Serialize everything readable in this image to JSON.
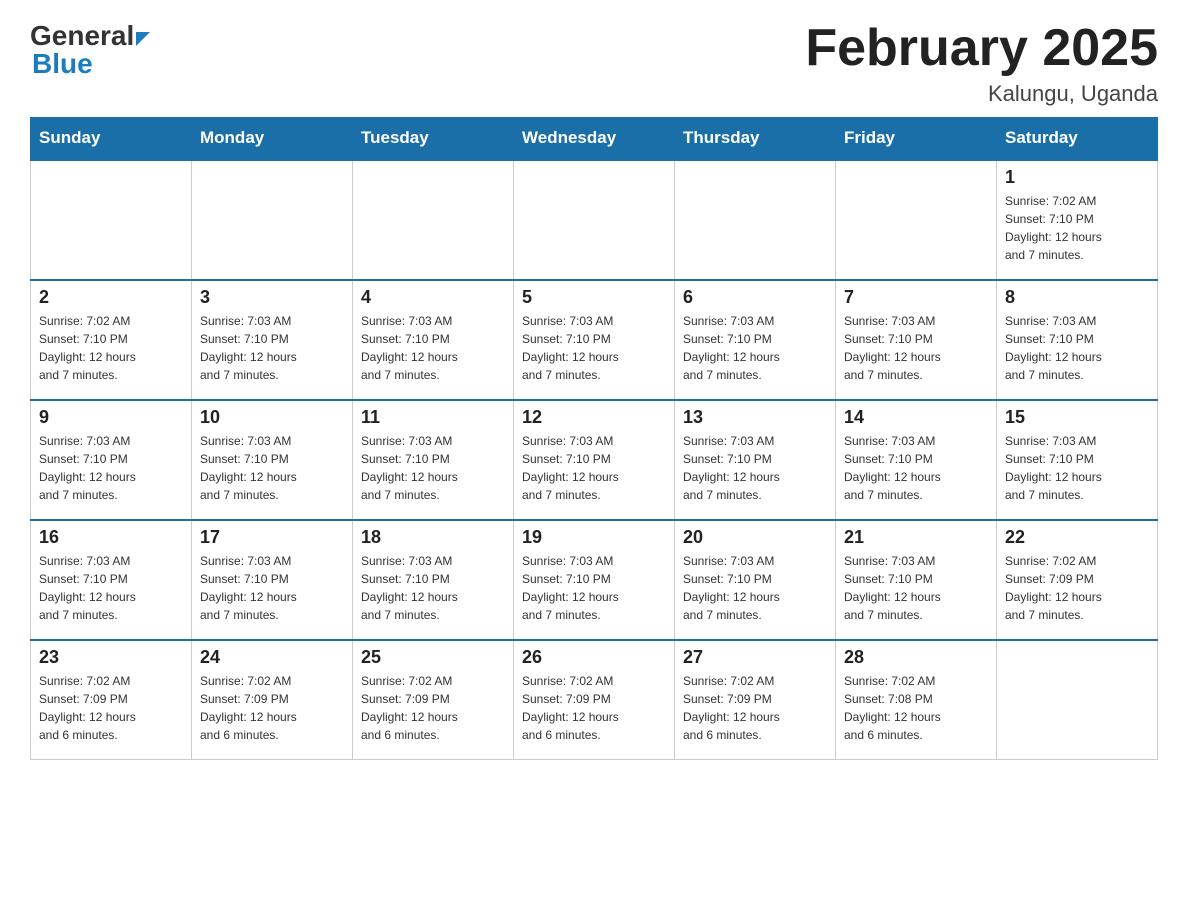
{
  "header": {
    "logo_general": "General",
    "logo_blue": "Blue",
    "title": "February 2025",
    "location": "Kalungu, Uganda"
  },
  "days_of_week": [
    "Sunday",
    "Monday",
    "Tuesday",
    "Wednesday",
    "Thursday",
    "Friday",
    "Saturday"
  ],
  "weeks": [
    [
      {
        "day": "",
        "info": ""
      },
      {
        "day": "",
        "info": ""
      },
      {
        "day": "",
        "info": ""
      },
      {
        "day": "",
        "info": ""
      },
      {
        "day": "",
        "info": ""
      },
      {
        "day": "",
        "info": ""
      },
      {
        "day": "1",
        "info": "Sunrise: 7:02 AM\nSunset: 7:10 PM\nDaylight: 12 hours\nand 7 minutes."
      }
    ],
    [
      {
        "day": "2",
        "info": "Sunrise: 7:02 AM\nSunset: 7:10 PM\nDaylight: 12 hours\nand 7 minutes."
      },
      {
        "day": "3",
        "info": "Sunrise: 7:03 AM\nSunset: 7:10 PM\nDaylight: 12 hours\nand 7 minutes."
      },
      {
        "day": "4",
        "info": "Sunrise: 7:03 AM\nSunset: 7:10 PM\nDaylight: 12 hours\nand 7 minutes."
      },
      {
        "day": "5",
        "info": "Sunrise: 7:03 AM\nSunset: 7:10 PM\nDaylight: 12 hours\nand 7 minutes."
      },
      {
        "day": "6",
        "info": "Sunrise: 7:03 AM\nSunset: 7:10 PM\nDaylight: 12 hours\nand 7 minutes."
      },
      {
        "day": "7",
        "info": "Sunrise: 7:03 AM\nSunset: 7:10 PM\nDaylight: 12 hours\nand 7 minutes."
      },
      {
        "day": "8",
        "info": "Sunrise: 7:03 AM\nSunset: 7:10 PM\nDaylight: 12 hours\nand 7 minutes."
      }
    ],
    [
      {
        "day": "9",
        "info": "Sunrise: 7:03 AM\nSunset: 7:10 PM\nDaylight: 12 hours\nand 7 minutes."
      },
      {
        "day": "10",
        "info": "Sunrise: 7:03 AM\nSunset: 7:10 PM\nDaylight: 12 hours\nand 7 minutes."
      },
      {
        "day": "11",
        "info": "Sunrise: 7:03 AM\nSunset: 7:10 PM\nDaylight: 12 hours\nand 7 minutes."
      },
      {
        "day": "12",
        "info": "Sunrise: 7:03 AM\nSunset: 7:10 PM\nDaylight: 12 hours\nand 7 minutes."
      },
      {
        "day": "13",
        "info": "Sunrise: 7:03 AM\nSunset: 7:10 PM\nDaylight: 12 hours\nand 7 minutes."
      },
      {
        "day": "14",
        "info": "Sunrise: 7:03 AM\nSunset: 7:10 PM\nDaylight: 12 hours\nand 7 minutes."
      },
      {
        "day": "15",
        "info": "Sunrise: 7:03 AM\nSunset: 7:10 PM\nDaylight: 12 hours\nand 7 minutes."
      }
    ],
    [
      {
        "day": "16",
        "info": "Sunrise: 7:03 AM\nSunset: 7:10 PM\nDaylight: 12 hours\nand 7 minutes."
      },
      {
        "day": "17",
        "info": "Sunrise: 7:03 AM\nSunset: 7:10 PM\nDaylight: 12 hours\nand 7 minutes."
      },
      {
        "day": "18",
        "info": "Sunrise: 7:03 AM\nSunset: 7:10 PM\nDaylight: 12 hours\nand 7 minutes."
      },
      {
        "day": "19",
        "info": "Sunrise: 7:03 AM\nSunset: 7:10 PM\nDaylight: 12 hours\nand 7 minutes."
      },
      {
        "day": "20",
        "info": "Sunrise: 7:03 AM\nSunset: 7:10 PM\nDaylight: 12 hours\nand 7 minutes."
      },
      {
        "day": "21",
        "info": "Sunrise: 7:03 AM\nSunset: 7:10 PM\nDaylight: 12 hours\nand 7 minutes."
      },
      {
        "day": "22",
        "info": "Sunrise: 7:02 AM\nSunset: 7:09 PM\nDaylight: 12 hours\nand 7 minutes."
      }
    ],
    [
      {
        "day": "23",
        "info": "Sunrise: 7:02 AM\nSunset: 7:09 PM\nDaylight: 12 hours\nand 6 minutes."
      },
      {
        "day": "24",
        "info": "Sunrise: 7:02 AM\nSunset: 7:09 PM\nDaylight: 12 hours\nand 6 minutes."
      },
      {
        "day": "25",
        "info": "Sunrise: 7:02 AM\nSunset: 7:09 PM\nDaylight: 12 hours\nand 6 minutes."
      },
      {
        "day": "26",
        "info": "Sunrise: 7:02 AM\nSunset: 7:09 PM\nDaylight: 12 hours\nand 6 minutes."
      },
      {
        "day": "27",
        "info": "Sunrise: 7:02 AM\nSunset: 7:09 PM\nDaylight: 12 hours\nand 6 minutes."
      },
      {
        "day": "28",
        "info": "Sunrise: 7:02 AM\nSunset: 7:08 PM\nDaylight: 12 hours\nand 6 minutes."
      },
      {
        "day": "",
        "info": ""
      }
    ]
  ]
}
